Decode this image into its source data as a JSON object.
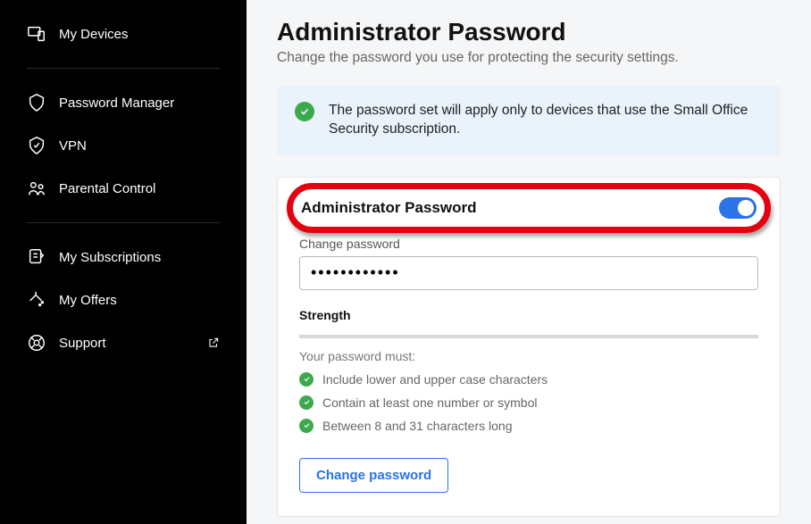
{
  "sidebar": {
    "items": [
      {
        "label": "My Devices",
        "icon": "devices-icon"
      },
      {
        "label": "Password Manager",
        "icon": "shield-key-icon"
      },
      {
        "label": "VPN",
        "icon": "vpn-icon"
      },
      {
        "label": "Parental Control",
        "icon": "family-icon"
      },
      {
        "label": "My Subscriptions",
        "icon": "subscriptions-icon"
      },
      {
        "label": "My Offers",
        "icon": "offers-icon"
      },
      {
        "label": "Support",
        "icon": "support-icon",
        "external": true
      }
    ]
  },
  "page": {
    "title": "Administrator Password",
    "subtitle": "Change the password you use for protecting the security settings."
  },
  "banner": {
    "text": "The password set will apply only to devices that use the Small Office Security subscription."
  },
  "panel": {
    "toggle_label": "Administrator Password",
    "toggle_on": true,
    "field_label": "Change password",
    "password_value": "••••••••••••",
    "strength_label": "Strength",
    "requirements_heading": "Your password must:",
    "requirements": [
      "Include lower and upper case characters",
      "Contain at least one number or symbol",
      "Between 8 and 31 characters long"
    ],
    "button_label": "Change password"
  },
  "colors": {
    "accent": "#2a73e8",
    "success": "#3ca94d",
    "highlight": "#e4000f"
  }
}
